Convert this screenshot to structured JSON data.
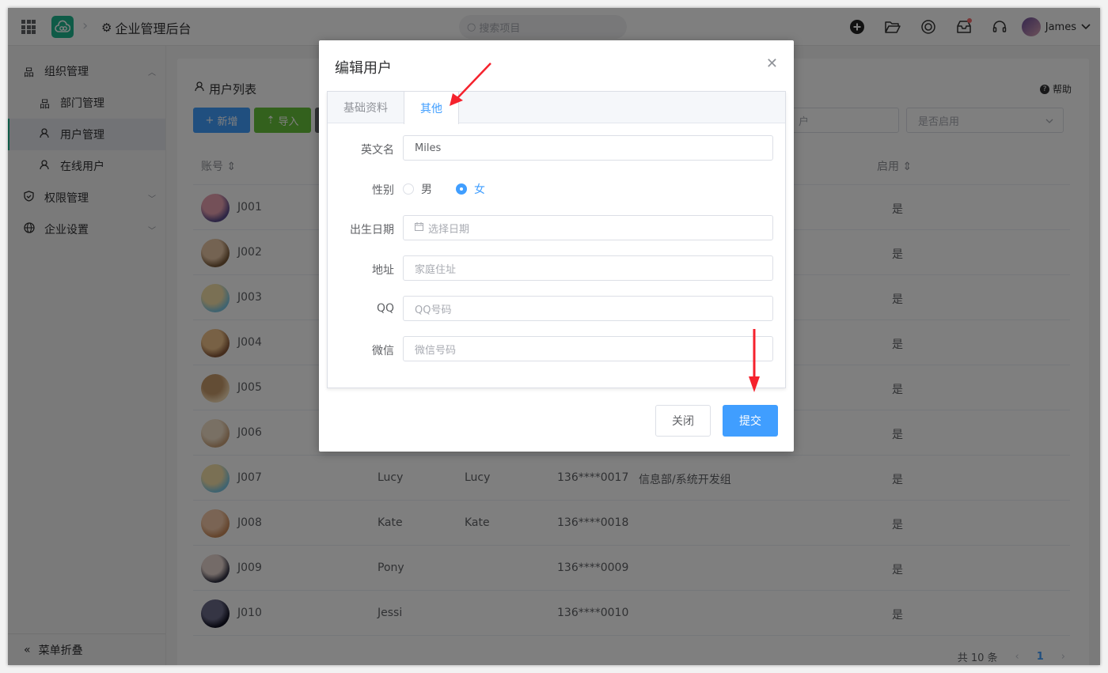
{
  "app": {
    "title": "企业管理后台",
    "search_placeholder": "搜索项目",
    "user_name": "James"
  },
  "sidebar": {
    "items": [
      {
        "label": "组织管理"
      },
      {
        "label": "部门管理"
      },
      {
        "label": "用户管理"
      },
      {
        "label": "在线用户"
      },
      {
        "label": "权限管理"
      },
      {
        "label": "企业设置"
      }
    ],
    "collapse_label": "菜单折叠"
  },
  "page": {
    "title": "用户列表",
    "help": "帮助",
    "btn_add": "新增",
    "btn_import": "导入",
    "filter_user_placeholder": "户",
    "filter_enabled_placeholder": "是否启用",
    "columns": {
      "account": "账号",
      "enabled": "启用"
    },
    "rows": [
      {
        "account": "J001",
        "enabled": "是"
      },
      {
        "account": "J002",
        "enabled": "是"
      },
      {
        "account": "J003",
        "enabled": "是"
      },
      {
        "account": "J004",
        "enabled": "是"
      },
      {
        "account": "J005",
        "enabled": "是"
      },
      {
        "account": "J006",
        "enabled": "是"
      },
      {
        "account": "J007",
        "name": "Lucy",
        "nickname": "Lucy",
        "phone": "136****0017",
        "dept": "信息部/系统开发组",
        "enabled": "是"
      },
      {
        "account": "J008",
        "name": "Kate",
        "nickname": "Kate",
        "phone": "136****0018",
        "dept": "",
        "enabled": "是"
      },
      {
        "account": "J009",
        "name": "Pony",
        "nickname": "",
        "phone": "136****0009",
        "dept": "",
        "enabled": "是"
      },
      {
        "account": "J010",
        "name": "Jessi",
        "nickname": "",
        "phone": "136****0010",
        "dept": "",
        "enabled": "是"
      }
    ],
    "pager": {
      "total": "共 10 条",
      "current": "1"
    }
  },
  "modal": {
    "title": "编辑用户",
    "tabs": {
      "basic": "基础资料",
      "other": "其他"
    },
    "fields": {
      "english_name": {
        "label": "英文名",
        "value": "Miles"
      },
      "gender": {
        "label": "性别",
        "male": "男",
        "female": "女",
        "selected": "女"
      },
      "birthday": {
        "label": "出生日期",
        "placeholder": "选择日期"
      },
      "address": {
        "label": "地址",
        "placeholder": "家庭住址"
      },
      "qq": {
        "label": "QQ",
        "placeholder": "QQ号码"
      },
      "wechat": {
        "label": "微信",
        "placeholder": "微信号码"
      }
    },
    "btn_close": "关闭",
    "btn_submit": "提交"
  },
  "colors": {
    "primary": "#409eff",
    "success": "#67c23a",
    "brand": "#1fb78f",
    "annotation_arrow": "#f5222d"
  }
}
